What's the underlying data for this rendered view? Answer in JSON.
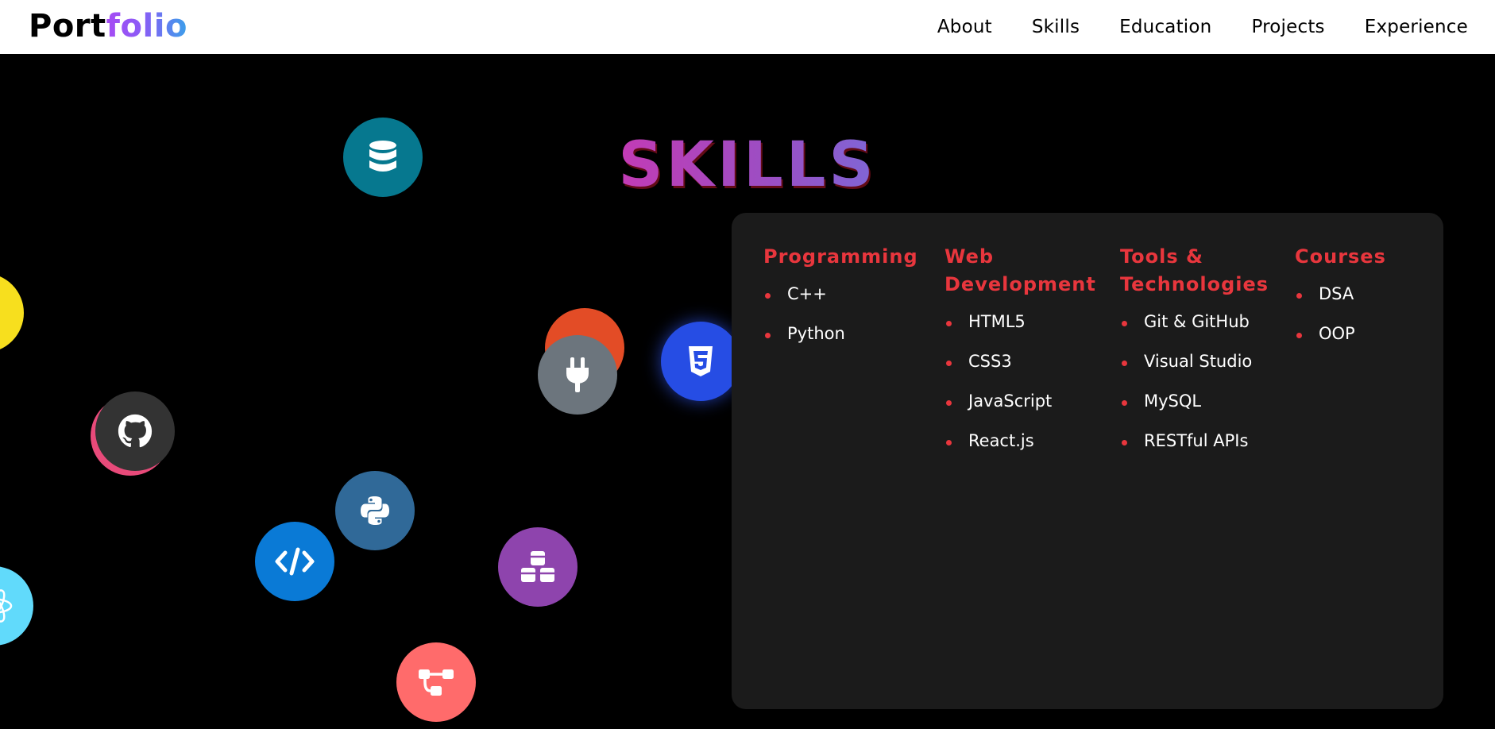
{
  "header": {
    "logo_part1": "Port",
    "logo_part2": "folio",
    "nav": [
      "About",
      "Skills",
      "Education",
      "Projects",
      "Experience"
    ]
  },
  "skills": {
    "title": "SKILLS",
    "categories": [
      {
        "title": "Programming",
        "items": [
          "C++",
          "Python"
        ]
      },
      {
        "title": "Web Development",
        "items": [
          "HTML5",
          "CSS3",
          "JavaScript",
          "React.js"
        ]
      },
      {
        "title": "Tools & Technologies",
        "items": [
          "Git & GitHub",
          "Visual Studio",
          "MySQL",
          "RESTful APIs"
        ]
      },
      {
        "title": "Courses",
        "items": [
          "DSA",
          "OOP"
        ]
      }
    ]
  },
  "icons": [
    {
      "name": "database-icon",
      "color": "#06788f"
    },
    {
      "name": "javascript-icon",
      "color": "#f7df1e"
    },
    {
      "name": "html5-icon",
      "color": "#e34c26"
    },
    {
      "name": "plug-icon",
      "color": "#6c757d"
    },
    {
      "name": "css3-icon",
      "color": "#264de4"
    },
    {
      "name": "github-icon",
      "color": "#333333"
    },
    {
      "name": "python-icon",
      "color": "#306998"
    },
    {
      "name": "code-icon",
      "color": "#0a7ad6"
    },
    {
      "name": "cubes-icon",
      "color": "#8e44ad"
    },
    {
      "name": "react-icon",
      "color": "#61dafb"
    },
    {
      "name": "git-branch-icon",
      "color": "#ff6b6b"
    }
  ],
  "colors": {
    "accent": "#e8363d",
    "card_bg": "#1b1b1b",
    "page_bg": "#000000"
  }
}
